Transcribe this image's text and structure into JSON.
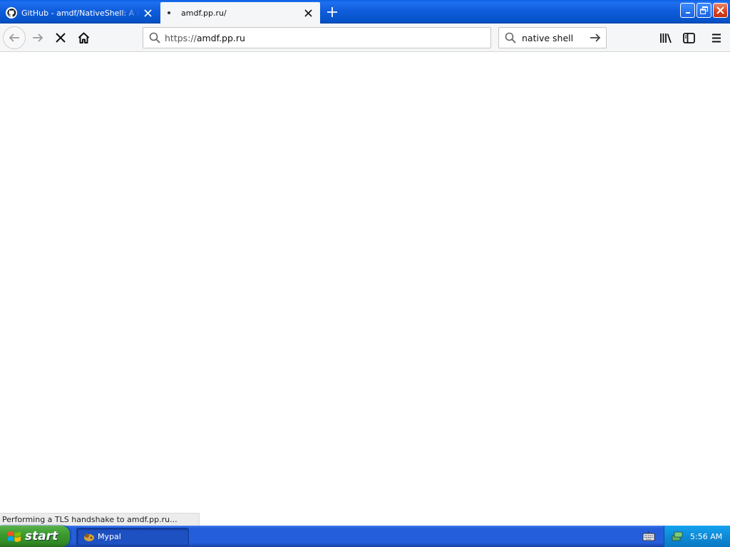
{
  "browser": {
    "tabs": [
      {
        "title": "GitHub - amdf/NativeShell: A shell",
        "active": false
      },
      {
        "title": "amdf.pp.ru/",
        "active": true
      }
    ],
    "url": {
      "scheme": "https://",
      "host": "amdf.pp.ru"
    },
    "search": {
      "value": "native shell"
    },
    "status": "Performing a TLS handshake to amdf.pp.ru..."
  },
  "taskbar": {
    "start_label": "start",
    "tasks": [
      {
        "label": "Mypal"
      }
    ],
    "clock": "5:56 AM"
  },
  "colors": {
    "titlebar_blue": "#0f5cdb",
    "start_green": "#3c9a2f",
    "tray_blue": "#0e8ad6",
    "close_red": "#d8401c"
  }
}
